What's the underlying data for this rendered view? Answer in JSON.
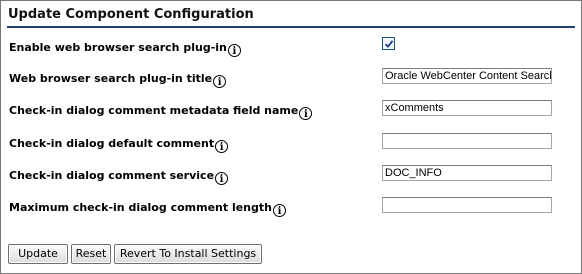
{
  "panel": {
    "title": "Update Component Configuration"
  },
  "fields": [
    {
      "label": "Enable web browser search plug-in",
      "type": "checkbox",
      "checked": true
    },
    {
      "label": "Web browser search plug-in title",
      "type": "text",
      "value": "Oracle WebCenter Content Search"
    },
    {
      "label": "Check-in dialog comment metadata field name",
      "type": "text",
      "value": "xComments"
    },
    {
      "label": "Check-in dialog default comment",
      "type": "text",
      "value": ""
    },
    {
      "label": "Check-in dialog comment service",
      "type": "text",
      "value": "DOC_INFO"
    },
    {
      "label": "Maximum check-in dialog comment length",
      "type": "text",
      "value": ""
    }
  ],
  "info_glyph": "i",
  "buttons": {
    "update": "Update",
    "reset": "Reset",
    "revert": "Revert To Install Settings"
  },
  "icons": {
    "info": "info-icon",
    "check": "checkmark-icon"
  },
  "colors": {
    "title_rule": "#1f3f75",
    "checkbox_border": "#1c5180",
    "button_border": "#6e6e6e"
  }
}
